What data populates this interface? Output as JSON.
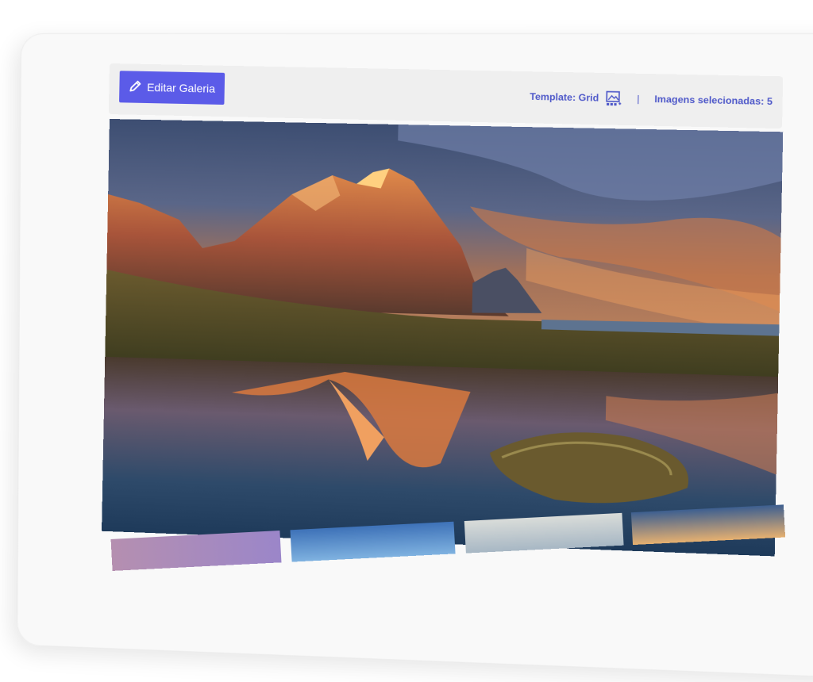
{
  "toolbar": {
    "edit_label": "Editar Galeria",
    "template_text": "Template: Grid",
    "separator": "|",
    "selected_text": "Imagens selecionadas: 5"
  },
  "icons": {
    "edit": "pencil-icon",
    "template": "gallery-grid-icon"
  },
  "gallery": {
    "hero_subject": "mountain-reflection-sunset",
    "thumbnail_count": 4
  },
  "colors": {
    "accent": "#5b5be8",
    "meta_text": "#4e58c9",
    "toolbar_bg": "#efefef"
  }
}
